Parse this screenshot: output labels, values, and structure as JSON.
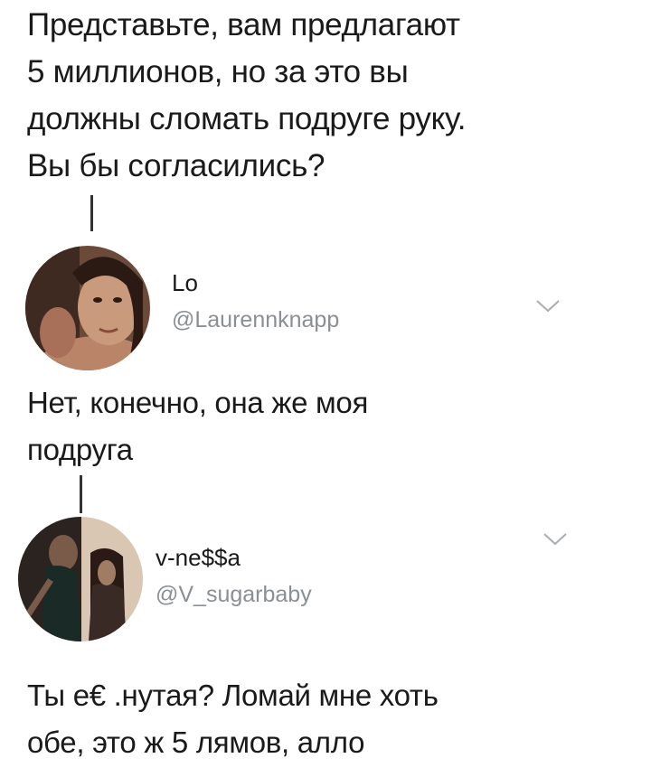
{
  "question": {
    "lines": [
      "Представьте, вам предлагают",
      "5 миллионов, но за это вы",
      "должны сломать подруге руку.",
      "Вы бы согласились?"
    ]
  },
  "replies": [
    {
      "display_name": "Lo",
      "handle": "@Laurennknapp",
      "text_lines": [
        "Нет, конечно, она же моя",
        "подруга"
      ],
      "menu_icon": "chevron-down-icon"
    },
    {
      "display_name": "v-ne$$a",
      "handle": "@V_sugarbaby",
      "text_lines": [
        "Ты е€ .нутая? Ломай мне хоть",
        "обе, это ж 5 лямов, алло"
      ],
      "menu_icon": "chevron-down-icon"
    }
  ],
  "colors": {
    "text": "#1a1a1a",
    "handle": "#8a8f94",
    "thread_line": "#333333",
    "chevron": "#a9adb2"
  }
}
